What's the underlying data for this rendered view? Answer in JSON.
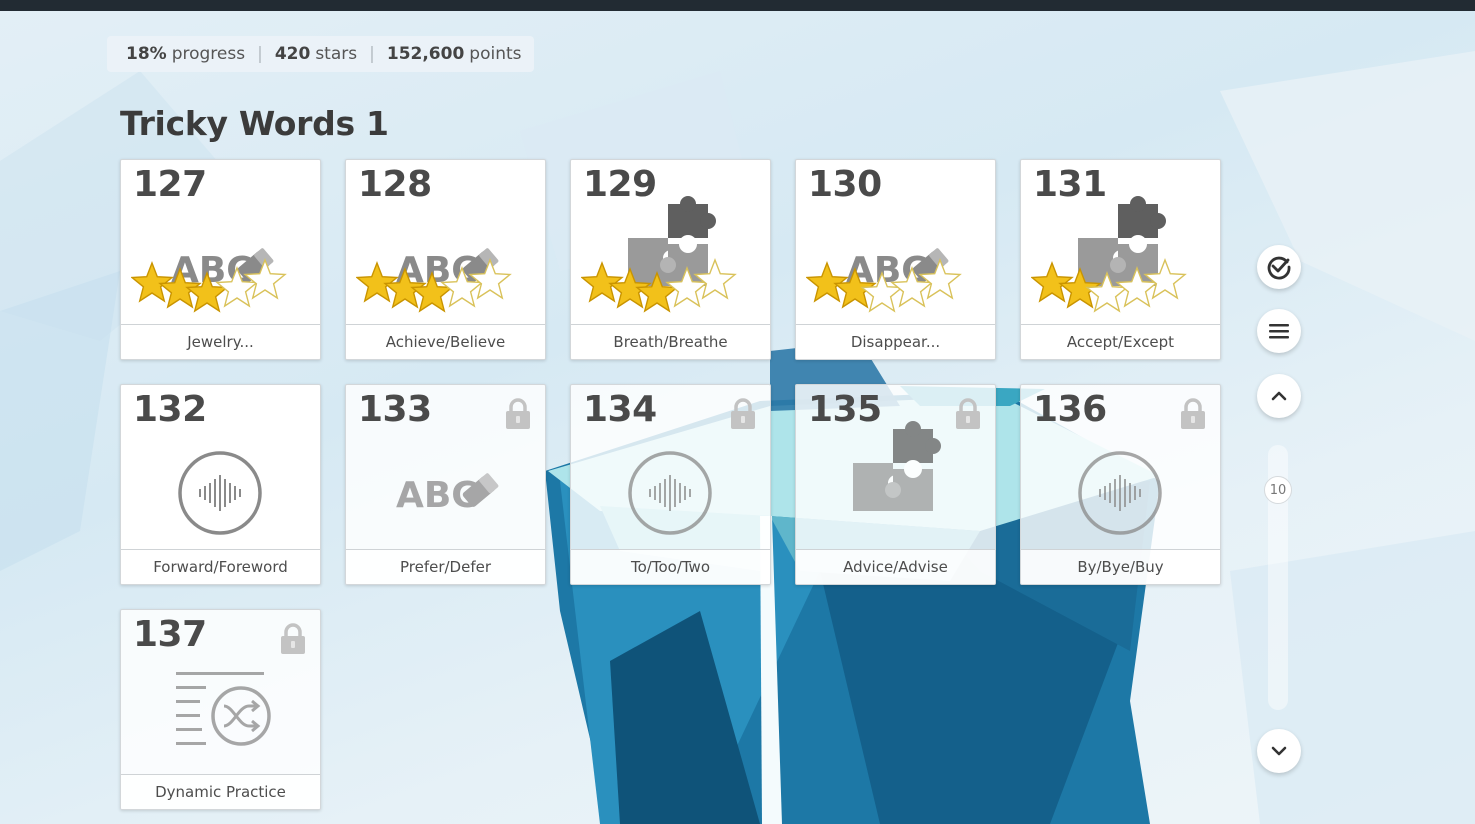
{
  "stats": {
    "progress_value": "18%",
    "progress_label": "progress",
    "stars_value": "420",
    "stars_label": "stars",
    "points_value": "152,600",
    "points_label": "points",
    "separator": "|"
  },
  "section": {
    "title": "Tricky Words 1"
  },
  "tiles": [
    {
      "number": "127",
      "label": "Jewelry...",
      "activity_icon": "abc-eraser-icon",
      "locked": false,
      "stars_earned": 3,
      "stars_total": 5
    },
    {
      "number": "128",
      "label": "Achieve/Believe",
      "activity_icon": "abc-eraser-icon",
      "locked": false,
      "stars_earned": 3,
      "stars_total": 5
    },
    {
      "number": "129",
      "label": "Breath/Breathe",
      "activity_icon": "puzzle-icon",
      "locked": false,
      "stars_earned": 3,
      "stars_total": 5
    },
    {
      "number": "130",
      "label": "Disappear...",
      "activity_icon": "abc-eraser-icon",
      "locked": false,
      "stars_earned": 2,
      "stars_total": 5
    },
    {
      "number": "131",
      "label": "Accept/Except",
      "activity_icon": "puzzle-icon",
      "locked": false,
      "stars_earned": 2,
      "stars_total": 5
    },
    {
      "number": "132",
      "label": "Forward/Foreword",
      "activity_icon": "audio-wave-icon",
      "locked": false
    },
    {
      "number": "133",
      "label": "Prefer/Defer",
      "activity_icon": "abc-eraser-icon",
      "locked": true
    },
    {
      "number": "134",
      "label": "To/Too/Two",
      "activity_icon": "audio-wave-icon",
      "locked": true
    },
    {
      "number": "135",
      "label": "Advice/Advise",
      "activity_icon": "puzzle-icon",
      "locked": true
    },
    {
      "number": "136",
      "label": "By/Bye/Buy",
      "activity_icon": "audio-wave-icon",
      "locked": true
    },
    {
      "number": "137",
      "label": "Dynamic Practice",
      "activity_icon": "shuffle-list-icon",
      "locked": true
    }
  ],
  "art_text": {
    "abc": "ABC"
  },
  "controls": {
    "level_indicator": "10"
  },
  "colors": {
    "star_fill": "#f2c11a",
    "icon_gray": "#8a8a8a",
    "dark_gray": "#5f5f5f",
    "topbar": "#222b33"
  }
}
